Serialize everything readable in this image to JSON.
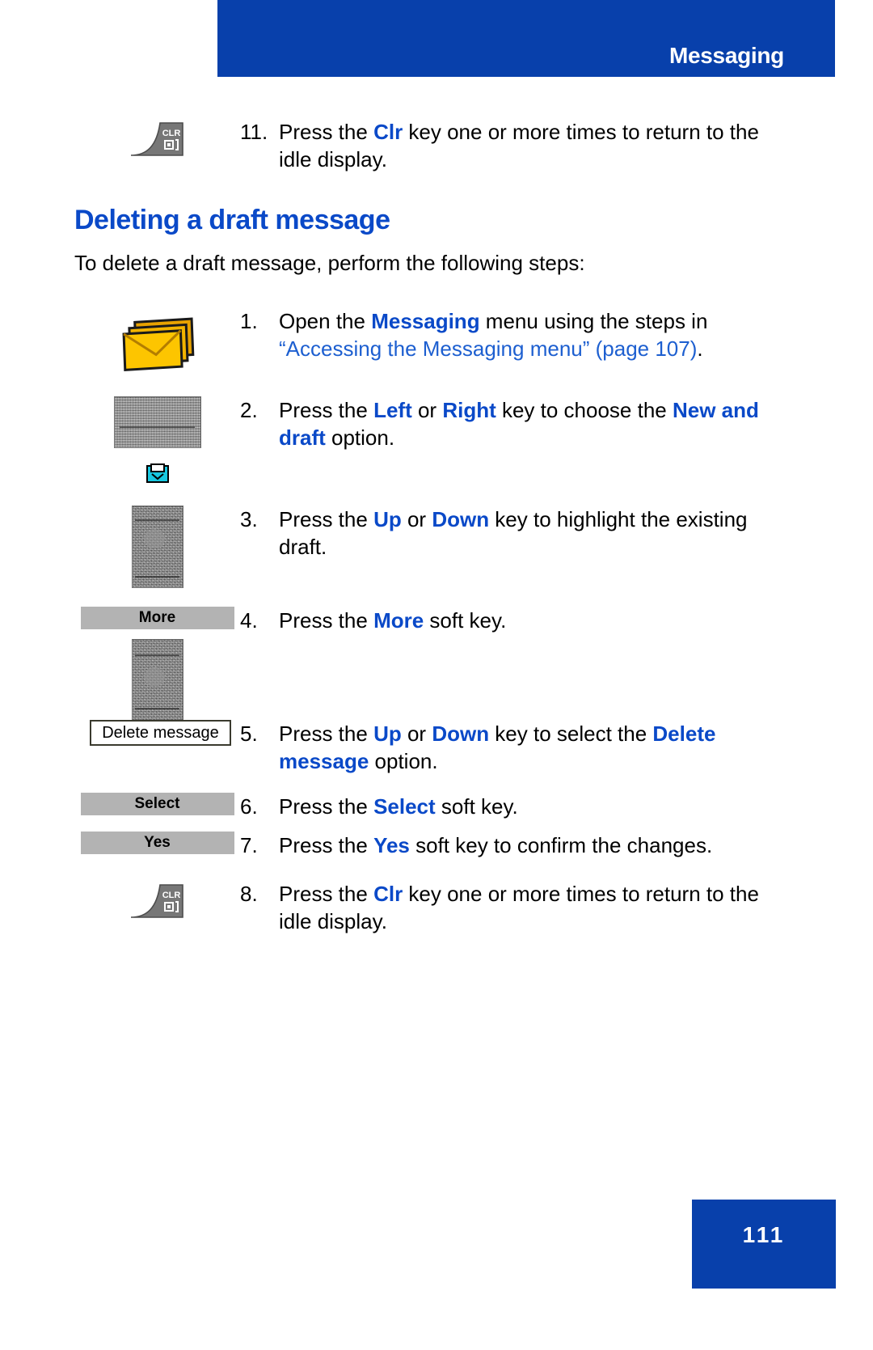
{
  "header": {
    "title": "Messaging",
    "bg_color": "#0840ab"
  },
  "section": {
    "heading": "Deleting a draft message",
    "intro": "To delete a draft message, perform the following steps:",
    "heading_color": "#0a49c8"
  },
  "top_step": {
    "number": "11.",
    "icon": "clr-key-icon",
    "icon_label": "CLR",
    "text_parts": {
      "p1": "Press the ",
      "k1": "Clr",
      "p2": " key one or more times to return to the idle display."
    }
  },
  "steps": [
    {
      "number": "1.",
      "icon": "envelope-stack-icon",
      "parts": {
        "p1": "Open the ",
        "k1": "Messaging",
        "p2": " menu using the steps in ",
        "link": "“Accessing the Messaging menu” (page 107)",
        "p3": "."
      }
    },
    {
      "number": "2.",
      "icon": "lcd-screen-new-and-draft",
      "badge": "envelope-badge-icon",
      "parts": {
        "p1": "Press the ",
        "k1": "Left",
        "p2": " or ",
        "k2": "Right",
        "p3": " key to choose the ",
        "k3": "New and draft",
        "p4": " option."
      }
    },
    {
      "number": "3.",
      "icon": "lcd-screen-draft-list",
      "parts": {
        "p1": "Press the ",
        "k1": "Up",
        "p2": " or ",
        "k2": "Down",
        "p3": " key to highlight the existing draft."
      }
    },
    {
      "number": "4.",
      "icon": "softkey-more",
      "softkey_label": "More",
      "parts": {
        "p1": "Press the ",
        "k1": "More",
        "p2": " soft key."
      }
    },
    {
      "number": "5.",
      "icon": "menu-option-delete-message",
      "option_label": "Delete message",
      "parts": {
        "p1": "Press the ",
        "k1": "Up",
        "p2": " or ",
        "k2": "Down",
        "p3": " key to select the ",
        "k3": "Delete message",
        "p4": " option."
      }
    },
    {
      "number": "6.",
      "icon": "softkey-select",
      "softkey_label": "Select",
      "parts": {
        "p1": "Press the ",
        "k1": "Select",
        "p2": " soft key."
      }
    },
    {
      "number": "7.",
      "icon": "softkey-yes",
      "softkey_label": "Yes",
      "parts": {
        "p1": "Press the ",
        "k1": "Yes",
        "p2": " soft key to confirm the changes."
      }
    },
    {
      "number": "8.",
      "icon": "clr-key-icon",
      "icon_label": "CLR",
      "parts": {
        "p1": "Press the ",
        "k1": "Clr",
        "p2": " key one or more times to return to the idle display."
      }
    }
  ],
  "footer": {
    "page_number": "111",
    "bg_color": "#0840ab"
  }
}
